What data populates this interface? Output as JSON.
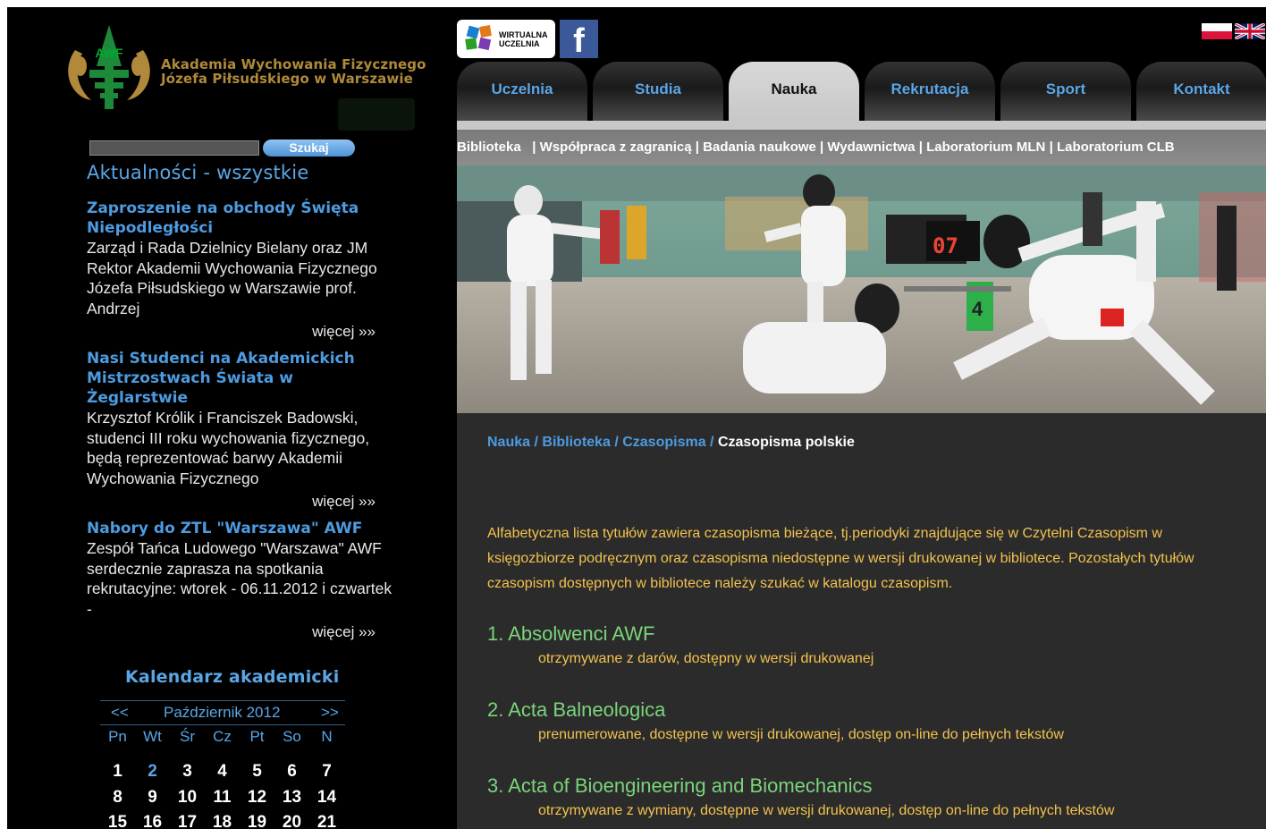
{
  "header": {
    "logo_line1": "Akademia Wychowania Fizycznego",
    "logo_line2": "Józefa Piłsudskiego w Warszawie",
    "logo_letters": "AWF",
    "wu_logo_line1": "WIRTUALNA",
    "wu_logo_line2": "UCZELNIA",
    "facebook_label": "f"
  },
  "search": {
    "input_value": "",
    "button_label": "Szukaj"
  },
  "news": {
    "heading": "Aktualności - wszystkie",
    "items": [
      {
        "title": "Zaproszenie na obchody Święta Niepodległości",
        "body": "  Zarząd i Rada Dzielnicy Bielany oraz JM Rektor Akademii Wychowania Fizycznego Józefa Piłsudskiego w Warszawie prof. Andrzej",
        "more": "więcej »»"
      },
      {
        "title": "Nasi Studenci na Akademickich Mistrzostwach Świata w Żeglarstwie",
        "body": "  Krzysztof Królik i Franciszek Badowski, studenci III roku wychowania fizycznego, będą reprezentować barwy Akademii Wychowania Fizycznego",
        "more": "więcej »»"
      },
      {
        "title": "Nabory do ZTL \"Warszawa\" AWF",
        "body": "  Zespół Tańca Ludowego \"Warszawa\" AWF serdecznie zaprasza na spotkania rekrutacyjne:   wtorek - 06.11.2012 i czwartek -",
        "more": "więcej »»"
      }
    ]
  },
  "calendar": {
    "title": "Kalendarz akademicki",
    "prev": "<<",
    "month": "Październik 2012",
    "next": ">>",
    "weekdays": [
      "Pn",
      "Wt",
      "Śr",
      "Cz",
      "Pt",
      "So",
      "N"
    ],
    "week1": [
      "1",
      "2",
      "3",
      "4",
      "5",
      "6",
      "7"
    ],
    "week2": [
      "8",
      "9",
      "10",
      "11",
      "12",
      "13",
      "14"
    ],
    "week3": [
      "15",
      "16",
      "17",
      "18",
      "19",
      "20",
      "21"
    ]
  },
  "nav": {
    "tabs": [
      "Uczelnia",
      "Studia",
      "Nauka",
      "Rekrutacja",
      "Sport",
      "Kontakt"
    ],
    "active_tab": "Nauka",
    "subnav": [
      "Biblioteka",
      "Współpraca z zagranicą",
      "Badania naukowe",
      "Wydawnictwa",
      "Laboratorium MLN",
      "Laboratorium CLB"
    ]
  },
  "hero": {
    "scoreboard": "07",
    "piste_number": "4"
  },
  "breadcrumb": {
    "items": [
      "Nauka",
      "Biblioteka",
      "Czasopisma"
    ],
    "separator": "/",
    "current": "Czasopisma polskie"
  },
  "content": {
    "intro": "Alfabetyczna lista tytułów zawiera czasopisma bieżące, tj.periodyki znajdujące się w Czytelni Czasopism w księgozbiorze podręcznym oraz czasopisma niedostępne w wersji drukowanej w bibliotece. Pozostałych tytułów czasopism dostępnych w bibliotece należy szukać w katalogu czasopism.",
    "journals": [
      {
        "title": "1. Absolwenci AWF",
        "desc": "otrzymywane z darów, dostępny w wersji drukowanej"
      },
      {
        "title": "2. Acta Balneologica",
        "desc": "prenumerowane, dostępne w wersji drukowanej, dostęp on-line do pełnych tekstów"
      },
      {
        "title": "3. Acta of Bioengineering and Biomechanics",
        "desc": "otrzymywane z wymiany, dostępne w wersji drukowanej, dostęp on-line do pełnych tekstów"
      }
    ]
  },
  "colors": {
    "accent_blue": "#5aa6e6",
    "text_yellow": "#f3c24e",
    "title_green": "#7bd47b",
    "logo_gold": "#b0893b",
    "logo_green": "#1d8a3a"
  }
}
